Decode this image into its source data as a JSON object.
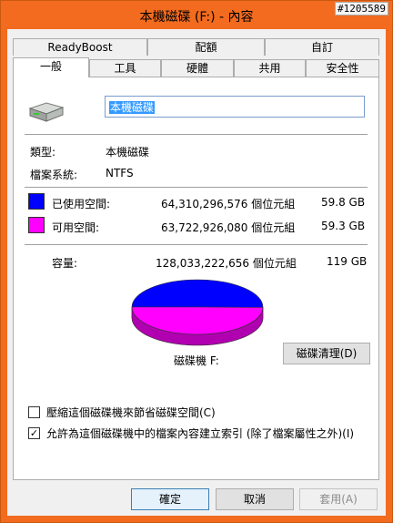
{
  "window": {
    "title": "本機磁碟 (F:) - 內容",
    "stamp": "#1205589"
  },
  "tabs_row1": [
    "ReadyBoost",
    "配額",
    "自訂"
  ],
  "tabs_row2": [
    "一般",
    "工具",
    "硬體",
    "共用",
    "安全性"
  ],
  "general": {
    "name_value": "本機磁碟",
    "type_label": "類型:",
    "type_value": "本機磁碟",
    "fs_label": "檔案系統:",
    "fs_value": "NTFS",
    "used": {
      "label": "已使用空間:",
      "bytes": "64,310,296,576 個位元組",
      "size": "59.8 GB",
      "color": "#0000ff"
    },
    "free": {
      "label": "可用空間:",
      "bytes": "63,722,926,080 個位元組",
      "size": "59.3 GB",
      "color": "#ff00ff"
    },
    "capacity": {
      "label": "容量:",
      "bytes": "128,033,222,656 個位元組",
      "size": "119 GB"
    },
    "drive_label": "磁碟機 F:",
    "cleanup_button": "磁碟清理(D)",
    "compress_label": "壓縮這個磁碟機來節省磁碟空間(C)",
    "compress_checked": false,
    "index_label": "允許為這個磁碟機中的檔案內容建立索引 (除了檔案屬性之外)(I)",
    "index_checked": true
  },
  "chart_data": {
    "type": "pie",
    "categories": [
      "已使用空間",
      "可用空間"
    ],
    "values": [
      59.8,
      59.3
    ],
    "colors": [
      "#0000ff",
      "#ff00ff"
    ]
  },
  "footer": {
    "ok": "確定",
    "cancel": "取消",
    "apply": "套用(A)"
  }
}
